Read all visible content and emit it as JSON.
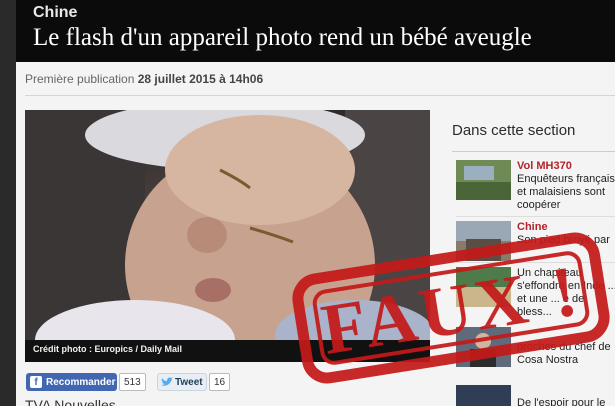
{
  "header": {
    "kicker": "Chine",
    "title": "Le flash d'un appareil photo rend un bébé aveugle"
  },
  "meta": {
    "pub_label": "Première publication",
    "pub_date": "28 juillet 2015 à 14h06"
  },
  "photo": {
    "caption": "Crédit photo : Europics / Daily Mail"
  },
  "social": {
    "fb_label": "Recommander",
    "fb_count": "513",
    "tw_label": "Tweet",
    "tw_count": "16"
  },
  "footer_partial": "TVA Nouvelles",
  "sidebar": {
    "heading": "Dans cette section",
    "items": [
      {
        "category": "Vol MH370",
        "text": "Enquêteurs français et malaisiens sont coopérer"
      },
      {
        "category": "Chine",
        "text": "Son pied broyé par"
      },
      {
        "category": "",
        "text": "Un chapiteau s'effondre en Inde ... et une ... e de bless..."
      },
      {
        "category": "",
        "text": "proches du chef de Cosa Nostra"
      },
      {
        "category": "",
        "text": "De l'espoir pour le"
      }
    ]
  },
  "stamp": {
    "text": "FAUX !",
    "color": "#c41a1a"
  }
}
